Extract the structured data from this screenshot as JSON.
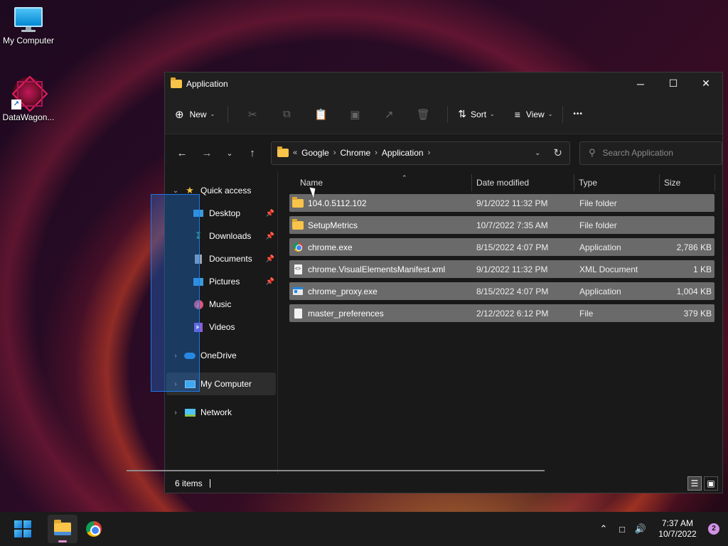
{
  "desktop": {
    "icons": [
      {
        "label": "My Computer",
        "icon": "computer-icon"
      },
      {
        "label": "DataWagon...",
        "icon": "datawagon-icon"
      }
    ]
  },
  "window": {
    "title": "Application",
    "controls": {
      "minimize": "─",
      "maximize": "☐",
      "close": "✕"
    }
  },
  "toolbar": {
    "new_label": "New",
    "sort_label": "Sort",
    "view_label": "View",
    "more_label": "•••"
  },
  "address": {
    "overflow": "«",
    "crumbs": [
      "Google",
      "Chrome",
      "Application"
    ],
    "search_placeholder": "Search Application"
  },
  "navpane": {
    "quick_access": "Quick access",
    "pinned": [
      {
        "label": "Desktop",
        "icon": "desktop-icon",
        "color": "#3a9bdc"
      },
      {
        "label": "Downloads",
        "icon": "download-icon",
        "color": "#3ec36b"
      },
      {
        "label": "Documents",
        "icon": "documents-icon",
        "color": "#9aa6b2"
      },
      {
        "label": "Pictures",
        "icon": "pictures-icon",
        "color": "#3a9bdc"
      },
      {
        "label": "Music",
        "icon": "music-icon",
        "color": "#e0557a"
      },
      {
        "label": "Videos",
        "icon": "videos-icon",
        "color": "#8e5cd9"
      }
    ],
    "onedrive": "OneDrive",
    "my_computer": "My Computer",
    "network": "Network"
  },
  "columns": {
    "name": "Name",
    "date": "Date modified",
    "type": "Type",
    "size": "Size"
  },
  "files": [
    {
      "name": "104.0.5112.102",
      "date": "9/1/2022 11:32 PM",
      "type": "File folder",
      "size": "",
      "icon": "folder-icon"
    },
    {
      "name": "SetupMetrics",
      "date": "10/7/2022 7:35 AM",
      "type": "File folder",
      "size": "",
      "icon": "folder-icon"
    },
    {
      "name": "chrome.exe",
      "date": "8/15/2022 4:07 PM",
      "type": "Application",
      "size": "2,786 KB",
      "icon": "chrome-icon"
    },
    {
      "name": "chrome.VisualElementsManifest.xml",
      "date": "9/1/2022 11:32 PM",
      "type": "XML Document",
      "size": "1 KB",
      "icon": "xml-icon"
    },
    {
      "name": "chrome_proxy.exe",
      "date": "8/15/2022 4:07 PM",
      "type": "Application",
      "size": "1,004 KB",
      "icon": "exe-icon"
    },
    {
      "name": "master_preferences",
      "date": "2/12/2022 6:12 PM",
      "type": "File",
      "size": "379 KB",
      "icon": "file-icon"
    }
  ],
  "status": {
    "items": "6 items"
  },
  "taskbar": {
    "time": "7:37 AM",
    "date": "10/7/2022",
    "notifications": "2"
  },
  "colors": {
    "accent": "#1e78e6",
    "folder": "#f8c449",
    "row_selected": "#6a6a6a"
  }
}
